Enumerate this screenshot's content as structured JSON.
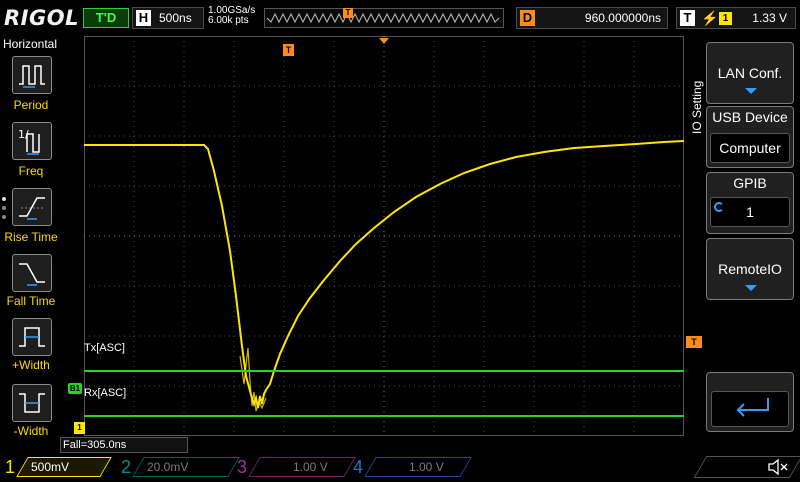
{
  "topbar": {
    "logo": "RIGOL",
    "trigger_status": "T'D",
    "horizontal_key": "H",
    "timebase": "500ns",
    "sample_rate": "1.00GSa/s",
    "memory_depth": "6.00k pts",
    "memory_trigger_marker": "T",
    "delay_key": "D",
    "delay_value": "960.000000ns",
    "trigger_key": "T",
    "trigger_edge_symbol": "⚡",
    "trigger_source": "1",
    "trigger_level": "1.33 V"
  },
  "left_menu": {
    "title": "Horizontal",
    "items": [
      {
        "label": "Period",
        "icon": "period-icon"
      },
      {
        "label": "Freq",
        "icon": "freq-icon"
      },
      {
        "label": "Rise Time",
        "icon": "rise-time-icon"
      },
      {
        "label": "Fall Time",
        "icon": "fall-time-icon"
      },
      {
        "label": "+Width",
        "icon": "positive-width-icon"
      },
      {
        "label": "-Width",
        "icon": "negative-width-icon"
      }
    ]
  },
  "waveform": {
    "trigger_top_marker": "T",
    "trigger_level_marker": "T",
    "bus_marker": "B1",
    "ch1_marker": "1",
    "tx_label": "Tx[ASC]",
    "rx_label": "Rx[ASC]",
    "trace_color": "#ffe600",
    "bus_color": "#2bd02b"
  },
  "measurement": {
    "fall_readout": "Fall=305.0ns"
  },
  "right_menu": {
    "title": "IO Setting",
    "lan_button": "LAN Conf.",
    "usb_title": "USB Device",
    "usb_value": "Computer",
    "gpib_title": "GPIB",
    "gpib_value": "1",
    "remote_button": "RemoteIO",
    "back_icon": "return-arrow-icon"
  },
  "channels": [
    {
      "num": "1",
      "scale": "500mV",
      "color": "#ffe600",
      "active": true
    },
    {
      "num": "2",
      "scale": "20.0mV",
      "color": "#00c0c0",
      "active": false
    },
    {
      "num": "3",
      "scale": "1.00 V",
      "color": "#e040e0",
      "active": false
    },
    {
      "num": "4",
      "scale": "1.00 V",
      "color": "#2e7bff",
      "active": false
    }
  ]
}
